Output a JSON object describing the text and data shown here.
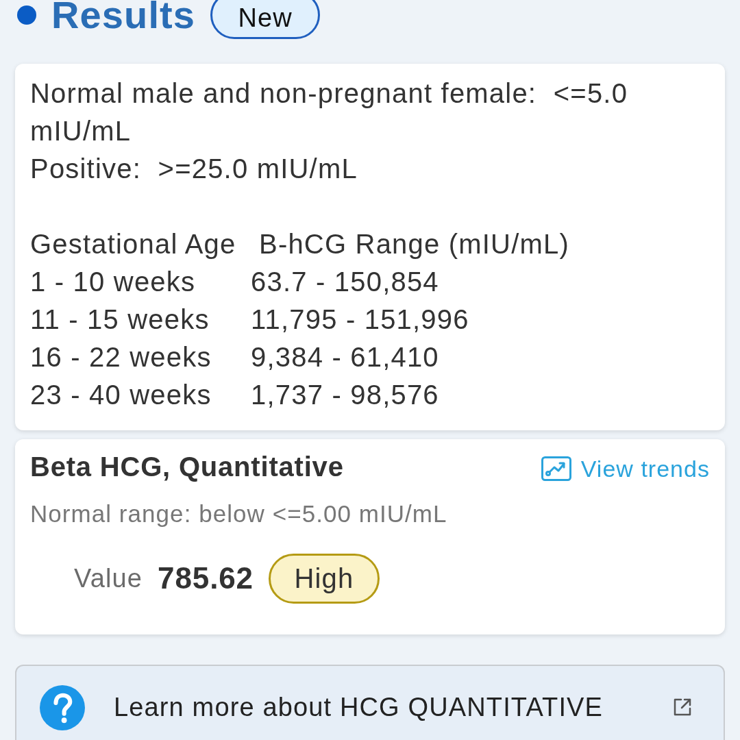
{
  "header": {
    "title": "Results",
    "badge": "New"
  },
  "reference_card": {
    "lines": [
      "Normal male and non-pregnant female:  <=5.0 mIU/mL",
      "Positive:  >=25.0 mIU/mL"
    ],
    "table": {
      "columns": [
        "Gestational Age",
        "B-hCG Range (mIU/mL)"
      ],
      "rows": [
        {
          "gestational_age": "1 - 10 weeks",
          "range": "63.7 - 150,854"
        },
        {
          "gestational_age": "11 - 15 weeks",
          "range": "11,795 - 151,996"
        },
        {
          "gestational_age": "16 - 22 weeks",
          "range": "9,384 - 61,410"
        },
        {
          "gestational_age": "23 - 40 weeks",
          "range": "1,737 - 98,576"
        }
      ]
    }
  },
  "result_card": {
    "title": "Beta HCG, Quantitative",
    "link": "View trends",
    "normal_range": "Normal range: below <=5.00 mIU/mL",
    "value_label": "Value",
    "value": "785.62",
    "flag": {
      "label": "High",
      "kind": "high"
    }
  },
  "learn_more": {
    "text": "Learn more about HCG QUANTITATIVE"
  }
}
